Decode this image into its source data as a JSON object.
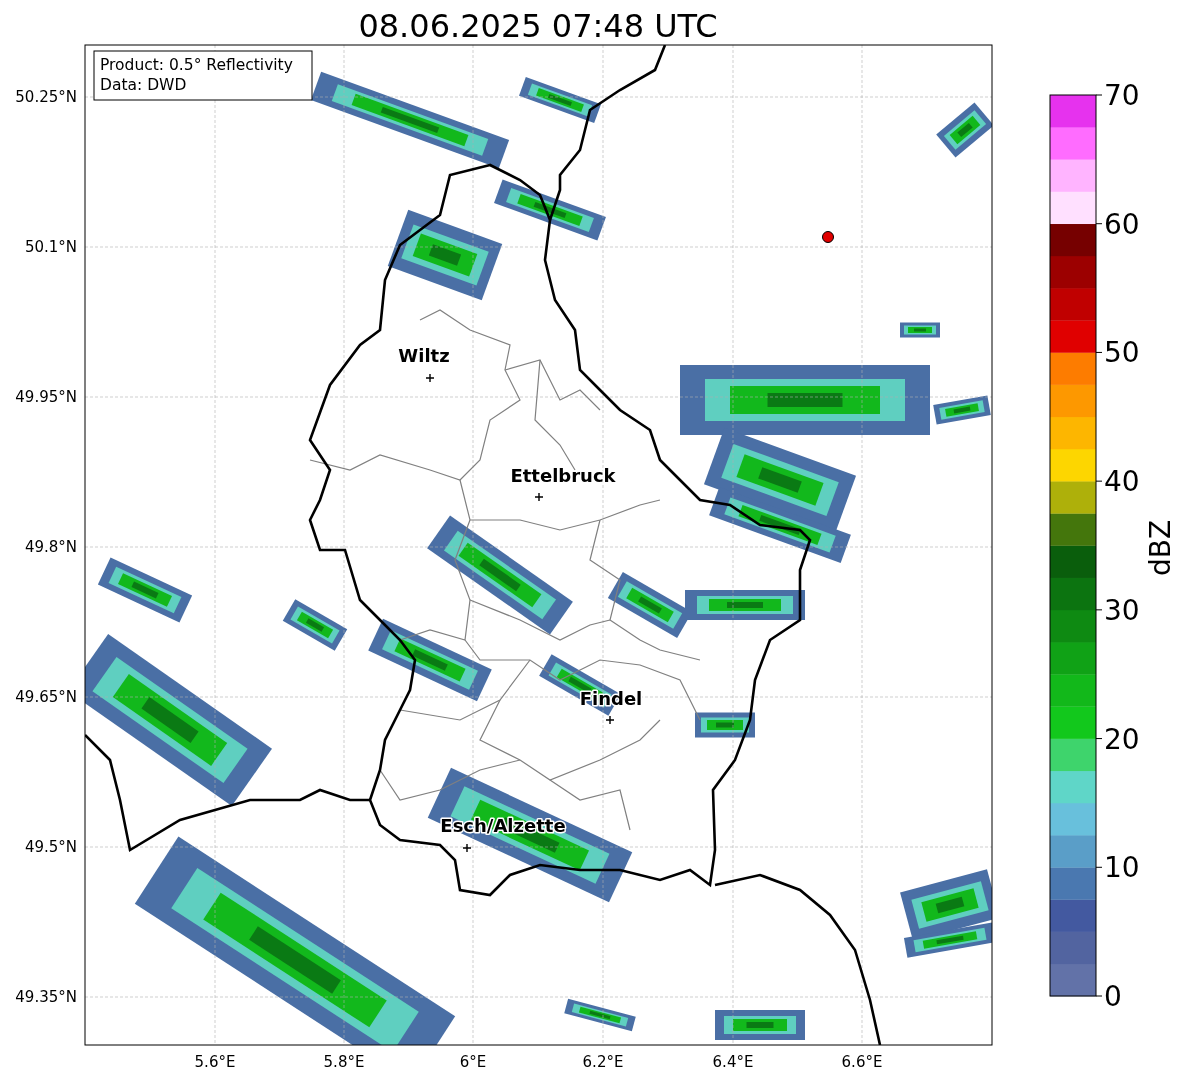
{
  "title": "08.06.2025 07:48 UTC",
  "legend": [
    "Product: 0.5° Reflectivity",
    "Data: DWD"
  ],
  "y_ticks": [
    "50.25°N",
    "50.1°N",
    "49.95°N",
    "49.8°N",
    "49.65°N",
    "49.5°N",
    "49.35°N"
  ],
  "x_ticks": [
    "5.6°E",
    "5.8°E",
    "6°E",
    "6.2°E",
    "6.4°E",
    "6.6°E"
  ],
  "cities": [
    {
      "name": "Wiltz"
    },
    {
      "name": "Ettelbruck"
    },
    {
      "name": "Findel"
    },
    {
      "name": "Esch/Alzette"
    }
  ],
  "colorbar": {
    "label": "dBZ",
    "ticks": [
      "70",
      "60",
      "50",
      "40",
      "30",
      "20",
      "10",
      "0"
    ]
  }
}
